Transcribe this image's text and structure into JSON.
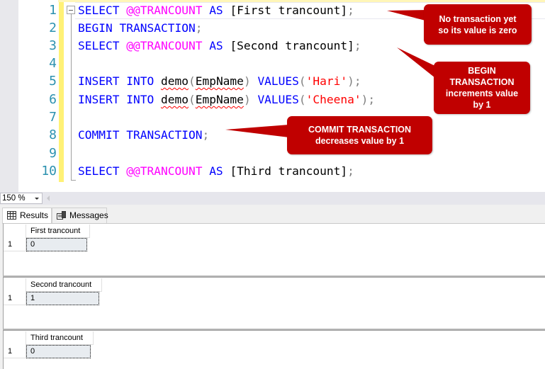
{
  "editor": {
    "lines": [
      {
        "num": "1"
      },
      {
        "num": "2"
      },
      {
        "num": "3"
      },
      {
        "num": "4"
      },
      {
        "num": "5"
      },
      {
        "num": "6"
      },
      {
        "num": "7"
      },
      {
        "num": "8"
      },
      {
        "num": "9"
      },
      {
        "num": "10"
      }
    ],
    "tokens": {
      "select": "SELECT",
      "trancount": "@@TRANCOUNT",
      "as": "AS",
      "begin": "BEGIN",
      "transaction": "TRANSACTION",
      "semicolon": ";",
      "insert": "INSERT",
      "into": "INTO",
      "table": "demo",
      "lparen": "(",
      "rparen": ")",
      "column": "EmpName",
      "values": "VALUES",
      "commit": "COMMIT",
      "alias1": "[First trancount]",
      "alias2": "[Second trancount]",
      "alias3": "[Third trancount]",
      "str1": "'Hari'",
      "str2": "'Cheena'"
    }
  },
  "callouts": {
    "first": "No transaction yet so its value is zero",
    "begin": "BEGIN TRANSACTION increments value by 1",
    "commit_line1": "COMMIT TRANSACTION",
    "commit_line2": "decreases value by 1"
  },
  "zoom": {
    "level": "150 %"
  },
  "tabs": {
    "results": "Results",
    "messages": "Messages"
  },
  "results": [
    {
      "header": "First trancount",
      "row": "1",
      "value": "0"
    },
    {
      "header": "Second trancount",
      "row": "1",
      "value": "1"
    },
    {
      "header": "Third trancount",
      "row": "1",
      "value": "0"
    }
  ],
  "colors": {
    "callout": "#c00000",
    "keyword": "#0000ff",
    "system_variable": "#ff00ff",
    "string": "#ff0000",
    "line_number": "#2b91af"
  }
}
